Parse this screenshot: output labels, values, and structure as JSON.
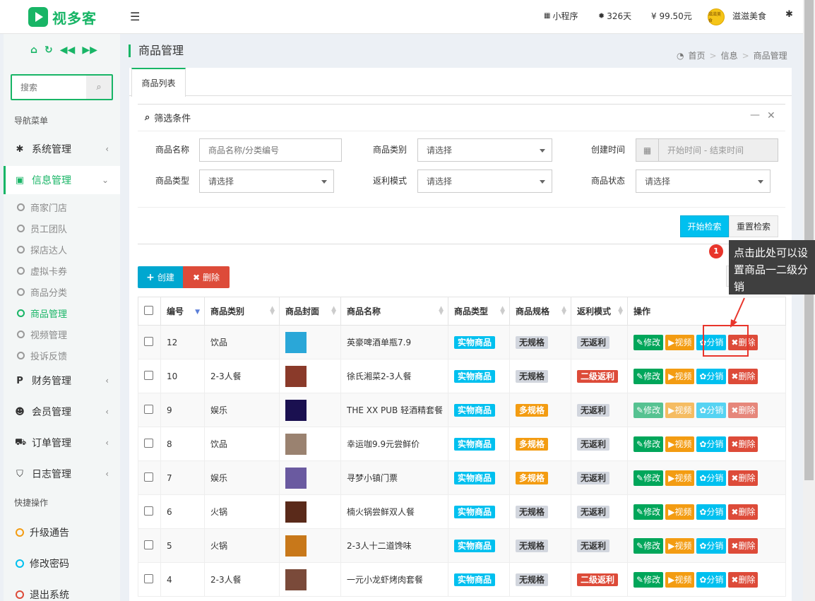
{
  "header": {
    "brand": "视多客",
    "mini_program": "小程序",
    "days": "326天",
    "balance": "¥ 99.50元",
    "avatar_text": "滋滋美食",
    "username": "滋滋美食"
  },
  "sidebar": {
    "search_placeholder": "搜索",
    "nav_header": "导航菜单",
    "menus": [
      {
        "label": "系统管理",
        "icon": "gear-icon"
      },
      {
        "label": "信息管理",
        "icon": "briefcase-icon"
      },
      {
        "label": "财务管理",
        "icon": "paypal-icon"
      },
      {
        "label": "会员管理",
        "icon": "users-icon"
      },
      {
        "label": "订单管理",
        "icon": "truck-icon"
      },
      {
        "label": "日志管理",
        "icon": "shield-icon"
      }
    ],
    "submenu": [
      "商家门店",
      "员工团队",
      "探店达人",
      "虚拟卡券",
      "商品分类",
      "商品管理",
      "视频管理",
      "投诉反馈"
    ],
    "quick_header": "快捷操作",
    "quick": [
      {
        "label": "升级通告",
        "color": "#f39c12"
      },
      {
        "label": "修改密码",
        "color": "#00c0ef"
      },
      {
        "label": "退出系统",
        "color": "#dd4b39"
      }
    ]
  },
  "page": {
    "title": "商品管理",
    "breadcrumb": [
      "首页",
      "信息",
      "商品管理"
    ],
    "tab": "商品列表"
  },
  "filter": {
    "title": "筛选条件",
    "name_label": "商品名称",
    "name_placeholder": "商品名称/分类编号",
    "cat_label": "商品类别",
    "cat_value": "请选择",
    "time_label": "创建时间",
    "time_placeholder": "开始时间 - 结束时间",
    "type_label": "商品类型",
    "type_value": "请选择",
    "rebate_label": "返利模式",
    "rebate_value": "请选择",
    "status_label": "商品状态",
    "status_value": "请选择",
    "search_btn": "开始检索",
    "reset_btn": "重置检索"
  },
  "toolbar": {
    "create": "创建",
    "delete": "删除"
  },
  "table": {
    "headers": [
      "编号",
      "商品类别",
      "商品封面",
      "商品名称",
      "商品类型",
      "商品规格",
      "返利模式",
      "操作"
    ],
    "rows": [
      {
        "id": "12",
        "cat": "饮品",
        "name": "英豪啤酒单瓶7.9",
        "type": "实物商品",
        "spec": "无规格",
        "rebate": "无返利",
        "thumb": "#2aa7d8"
      },
      {
        "id": "10",
        "cat": "2-3人餐",
        "name": "徐氏湘菜2-3人餐",
        "type": "实物商品",
        "spec": "无规格",
        "rebate": "二级返利",
        "thumb": "#8a3a2a"
      },
      {
        "id": "9",
        "cat": "娱乐",
        "name": "THE XX PUB 轻酒精套餐",
        "type": "实物商品",
        "spec": "多规格",
        "rebate": "无返利",
        "thumb": "#1a1050"
      },
      {
        "id": "8",
        "cat": "饮品",
        "name": "幸运咖9.9元尝鲜价",
        "type": "实物商品",
        "spec": "多规格",
        "rebate": "无返利",
        "thumb": "#9a8270"
      },
      {
        "id": "7",
        "cat": "娱乐",
        "name": "寻梦小镇门票",
        "type": "实物商品",
        "spec": "多规格",
        "rebate": "无返利",
        "thumb": "#6a5aa0"
      },
      {
        "id": "6",
        "cat": "火锅",
        "name": "楠火锅尝鲜双人餐",
        "type": "实物商品",
        "spec": "无规格",
        "rebate": "无返利",
        "thumb": "#5a2a1a"
      },
      {
        "id": "5",
        "cat": "火锅",
        "name": "2-3人十二道馋味",
        "type": "实物商品",
        "spec": "无规格",
        "rebate": "无返利",
        "thumb": "#c8781a"
      },
      {
        "id": "4",
        "cat": "2-3人餐",
        "name": "一元小龙虾烤肉套餐",
        "type": "实物商品",
        "spec": "无规格",
        "rebate": "二级返利",
        "thumb": "#7a4a3a"
      }
    ],
    "ops": {
      "edit": "修改",
      "video": "视频",
      "dist": "分销",
      "del": "删除"
    }
  },
  "tooltip": {
    "num": "1",
    "text": "点击此处可以设置商品一二级分销"
  }
}
